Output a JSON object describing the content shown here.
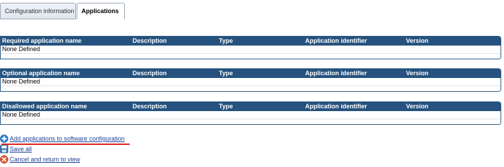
{
  "tabs": [
    {
      "label": "Configuration information"
    },
    {
      "label": "Applications"
    }
  ],
  "grids": [
    {
      "columns": [
        "Required application name",
        "Description",
        "Type",
        "Application identifier",
        "Version"
      ],
      "empty_text": "None Defined"
    },
    {
      "columns": [
        "Optional application name",
        "Description",
        "Type",
        "Application identifier",
        "Version"
      ],
      "empty_text": "None Defined"
    },
    {
      "columns": [
        "Disallowed application name",
        "Description",
        "Type",
        "Application identifier",
        "Version"
      ],
      "empty_text": "None Defined"
    }
  ],
  "actions": {
    "add_label": "Add applications to software configuration",
    "save_label": "Save all",
    "cancel_label": "Cancel and return to view"
  },
  "colors": {
    "header_bg": "#25527e",
    "link": "#1c3f95",
    "highlight": "#e0201a"
  }
}
